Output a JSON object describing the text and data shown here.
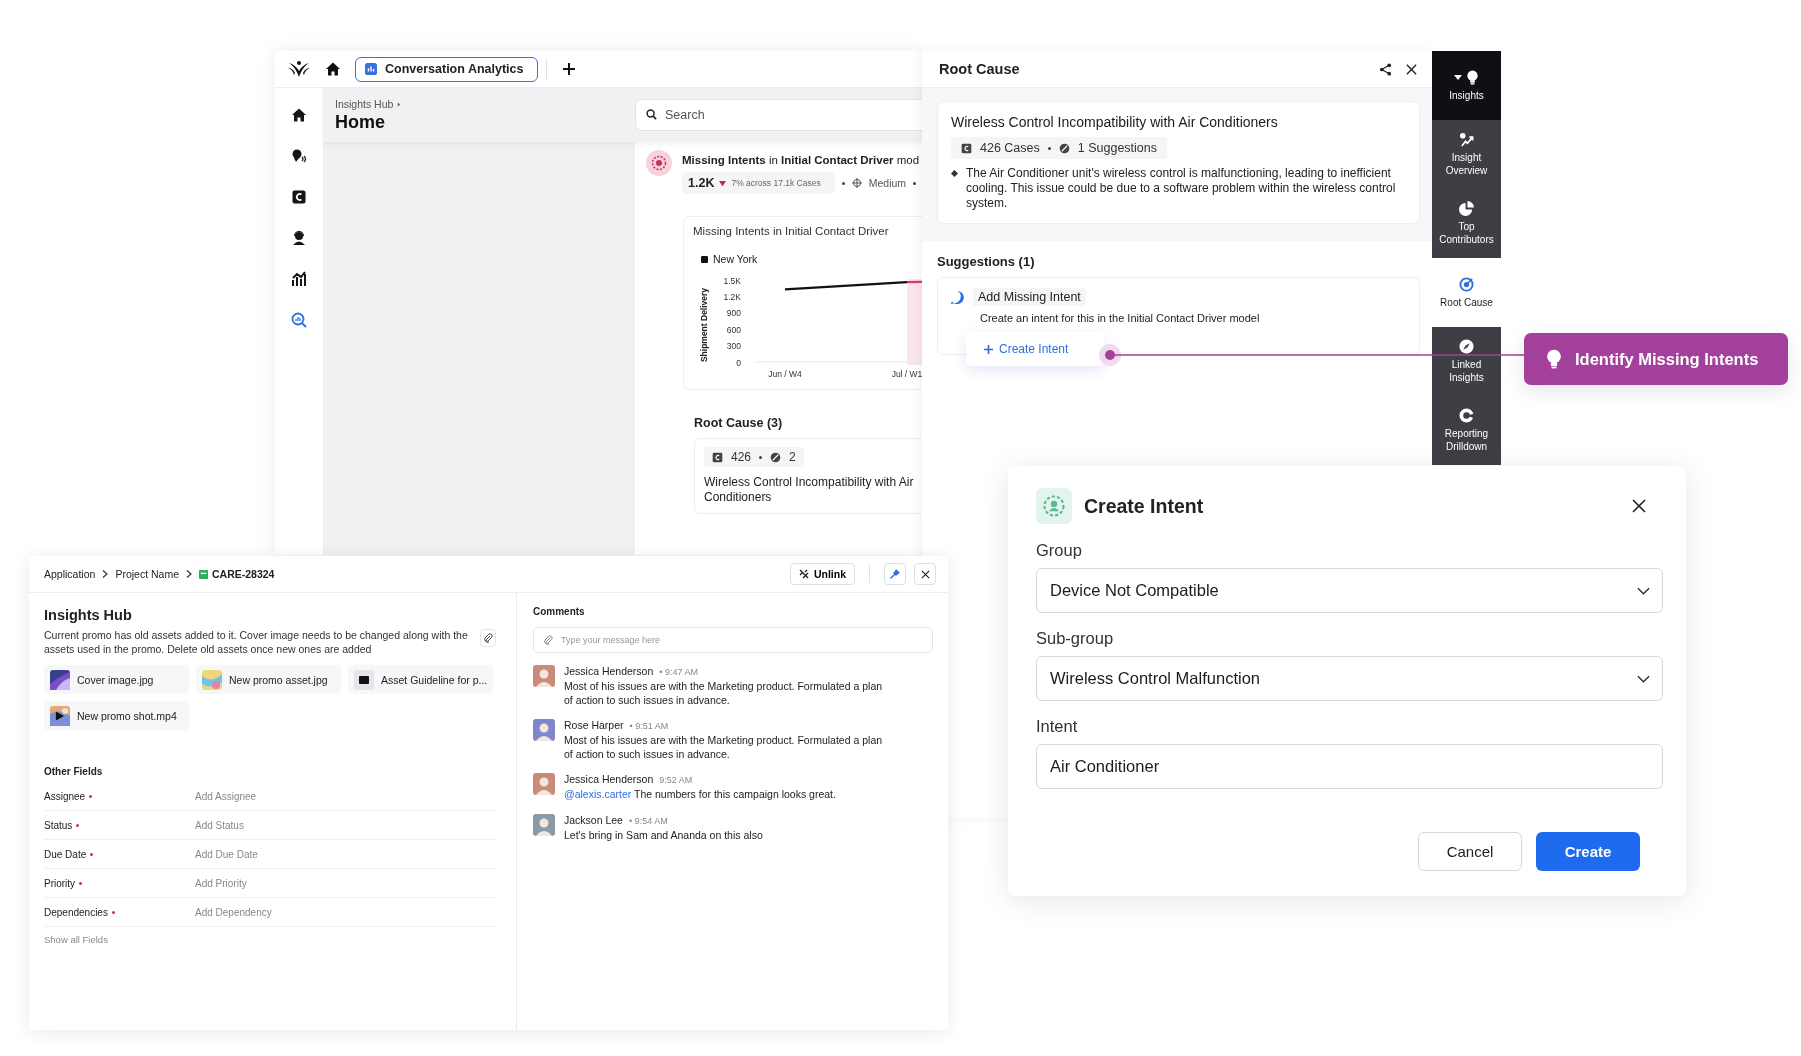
{
  "app_window": {
    "tab": {
      "label": "Conversation Analytics",
      "selected": true
    },
    "nav_items": [
      {
        "selected": false
      },
      {
        "selected": false
      },
      {
        "selected": false
      },
      {
        "selected": false
      },
      {
        "selected": false
      },
      {
        "selected": true
      }
    ],
    "breadcrumb": "Insights Hub",
    "page_title": "Home",
    "search": {
      "placeholder": "Search"
    },
    "insight": {
      "title": "**Missing Intents** in **Initial Contact Driver** mod",
      "count": "1.2K",
      "trend": "7% across 17.1k Cases",
      "severity": "Medium"
    },
    "chart_card": {
      "title": "Missing Intents in Initial Contact Driver",
      "chart_data": {
        "type": "line",
        "ylabel": "Shipment Delivery",
        "categories": [
          "Jun / W4",
          "Jul / W1"
        ],
        "series": [
          {
            "name": "New York",
            "color": "#111111",
            "values": [
              1330,
              1460
            ]
          }
        ],
        "ylim": [
          0,
          1500
        ],
        "yticks": [
          0,
          300,
          600,
          900,
          {
            "value": 1200,
            "label": "1.2K"
          },
          {
            "value": 1500,
            "label": "1.5K"
          }
        ]
      }
    },
    "root_cause_heading": "Root Cause (3)",
    "root_cause_card": {
      "cases": "426",
      "suggestions": "2",
      "title": "Wireless Control Incompatibility with Air Conditioners"
    }
  },
  "root_cause_panel": {
    "title": "Root Cause",
    "card": {
      "title": "Wireless Control Incompatibility with Air Conditioners",
      "cases": "426 Cases",
      "suggestions": "1 Suggestions",
      "description": "The Air Conditioner unit's wireless control is malfunctioning, leading to inefficient cooling. This issue could be due to a software problem within the wireless control system."
    },
    "suggestions_heading": "Suggestions (1)",
    "suggestion": {
      "title": "Add Missing Intent",
      "text": "Create an intent for this in the Initial Contact Driver model",
      "action": "Create Intent"
    }
  },
  "side_rail": [
    {
      "label": "Insights",
      "kind": "group",
      "selected": false
    },
    {
      "label": "Insight Overview",
      "kind": "item",
      "selected": false
    },
    {
      "label": "Top Contributors",
      "kind": "item",
      "selected": false
    },
    {
      "label": "Root Cause",
      "kind": "item",
      "selected": true
    },
    {
      "label": "Linked Insights",
      "kind": "item",
      "selected": false
    },
    {
      "label": "Reporting Drilldown",
      "kind": "item",
      "selected": false
    }
  ],
  "callout": "Identify Missing Intents",
  "create_intent_dialog": {
    "title": "Create Intent",
    "fields": [
      {
        "label": "Group",
        "kind": "select",
        "value": "Device Not Compatible"
      },
      {
        "label": "Sub-group",
        "kind": "select",
        "value": "Wireless Control Malfunction"
      },
      {
        "label": "Intent",
        "kind": "text",
        "value": "Air Conditioner"
      }
    ],
    "buttons": [
      {
        "label": "Cancel",
        "kind": "secondary"
      },
      {
        "label": "Create",
        "kind": "primary"
      }
    ]
  },
  "ticket_panel": {
    "breadcrumb": [
      "Application",
      "Project Name",
      "CARE-28324"
    ],
    "unlink": "Unlink",
    "title": "Insights Hub",
    "description": "Current promo has old assets added to it. Cover image needs to be changed along with the assets used in the promo. Delete old assets once new ones are added",
    "attachments": [
      {
        "name": "Cover image.jpg"
      },
      {
        "name": "New promo asset.jpg"
      },
      {
        "name": "Asset Guideline for p...",
        "kind": "document"
      },
      {
        "name": "New promo shot.mp4",
        "kind": "video"
      }
    ],
    "other_fields_heading": "Other Fields",
    "fields": [
      {
        "label": "Assignee",
        "placeholder": "Add Assignee",
        "required": true
      },
      {
        "label": "Status",
        "placeholder": "Add Status",
        "required": true
      },
      {
        "label": "Due Date",
        "placeholder": "Add Due Date",
        "required": true
      },
      {
        "label": "Priority",
        "placeholder": "Add Priority",
        "required": true
      },
      {
        "label": "Dependencies",
        "placeholder": "Add Dependency",
        "required": true
      }
    ],
    "show_all": "Show all Fields",
    "comments_heading": "Comments",
    "comment_input": {
      "placeholder": "Type your message here"
    },
    "comments": [
      {
        "author": "Jessica Henderson",
        "time": "• 9:47 AM",
        "text": "Most of his issues are with the Marketing product. Formulated a plan of action to such issues in advance."
      },
      {
        "author": "Rose Harper",
        "time": "• 9:51 AM",
        "text": "Most of his issues are with the Marketing product. Formulated a plan of action to such issues in advance."
      },
      {
        "author": "Jessica Henderson",
        "time": "9:52 AM",
        "mention": "@alexis.carter",
        "text": "The numbers for this campaign looks great."
      },
      {
        "author": "Jackson Lee",
        "time": "• 9:54 AM",
        "text": "Let's bring in Sam and Ananda on this also"
      }
    ]
  }
}
